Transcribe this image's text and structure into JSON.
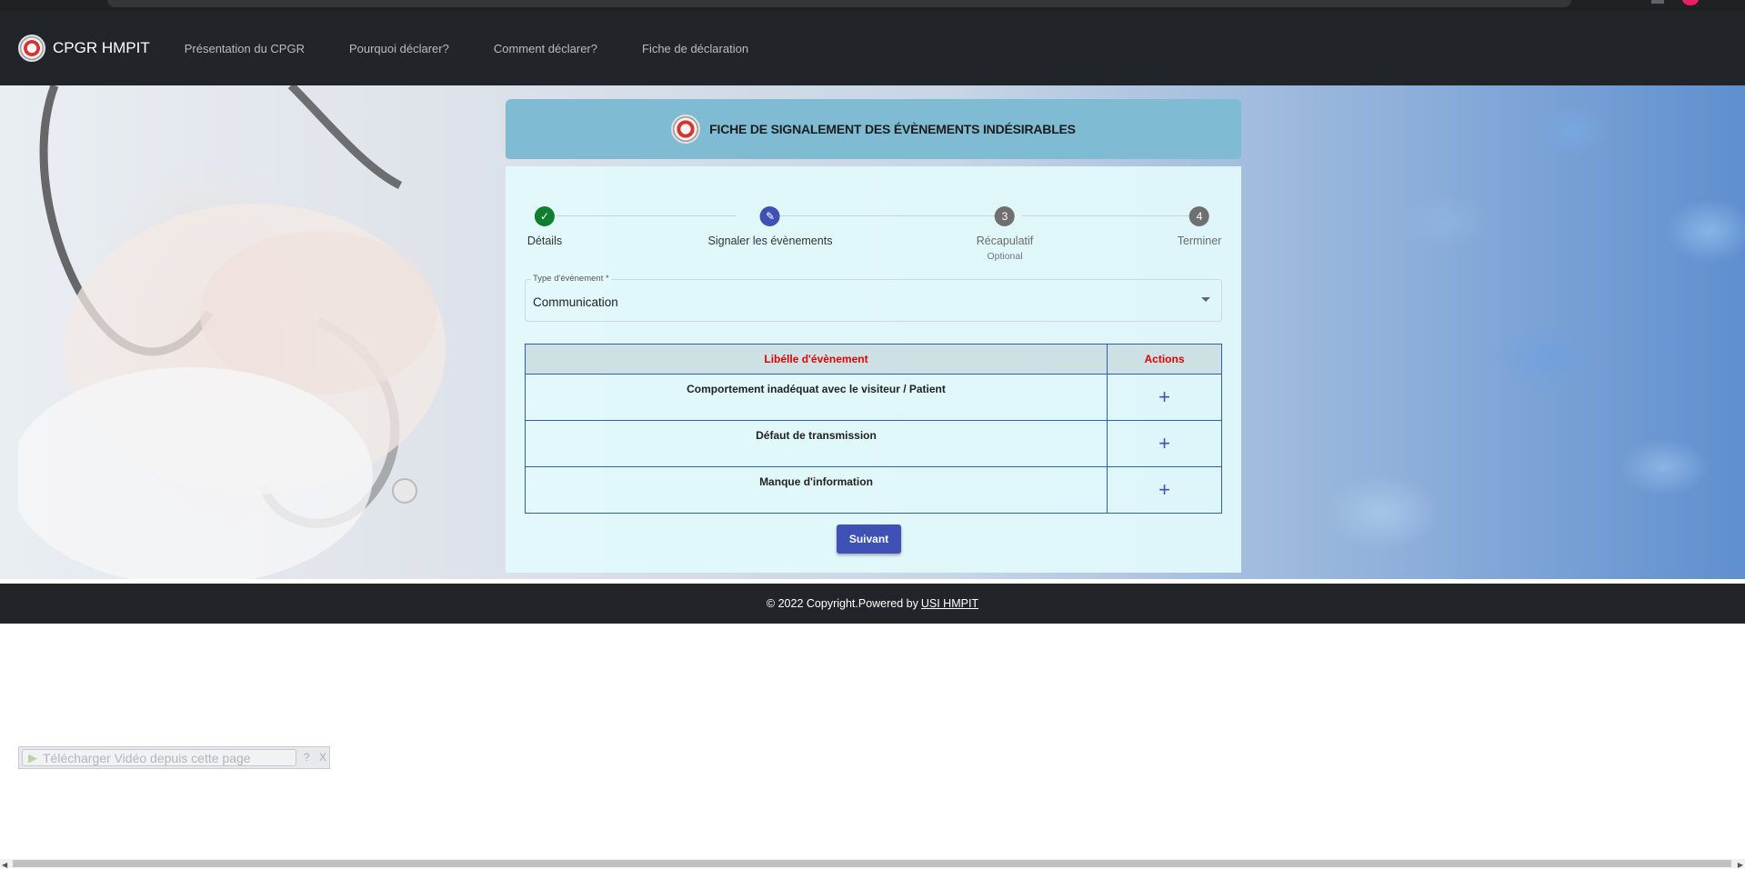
{
  "navbar": {
    "brand": "CPGR HMPIT",
    "links": [
      "Présentation du CPGR",
      "Pourquoi déclarer?",
      "Comment déclarer?",
      "Fiche de déclaration"
    ]
  },
  "form": {
    "title": "FICHE DE SIGNALEMENT DES ÉVÈNEMENTS INDÉSIRABLES",
    "steps": [
      {
        "label": "Détails",
        "state": "done",
        "icon": "check-icon"
      },
      {
        "label": "Signaler les évènements",
        "state": "active",
        "icon": "pencil-icon"
      },
      {
        "label": "Récapulatif",
        "number": "3",
        "sub": "Optional",
        "state": "todo"
      },
      {
        "label": "Terminer",
        "number": "4",
        "state": "todo"
      }
    ],
    "event_type": {
      "label": "Type d'évènement *",
      "value": "Communication"
    },
    "table": {
      "headers": [
        "Libélle d'évènement",
        "Actions"
      ],
      "rows": [
        {
          "label": "Comportement inadéquat avec le visiteur / Patient",
          "action": "+"
        },
        {
          "label": "Défaut de transmission",
          "action": "+"
        },
        {
          "label": "Manque d'information",
          "action": "+"
        }
      ]
    },
    "next_button": "Suivant"
  },
  "footer": {
    "text": "© 2022 Copyright.Powered by",
    "link": "USI HMPIT"
  },
  "download_bar": {
    "label": "Télécharger Vidéo depuis cette page",
    "help": "?",
    "close": "X"
  },
  "colors": {
    "navbar": "#212529",
    "header": "#7fbcd3",
    "accent": "#3f51b5",
    "done": "#0e7f2f",
    "table_header_text": "#e00000"
  }
}
